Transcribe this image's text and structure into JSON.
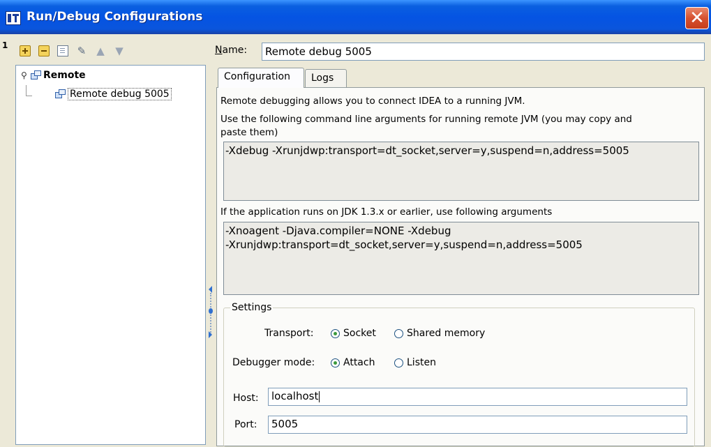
{
  "window": {
    "title": "Run/Debug Configurations",
    "close_glyph": "✕"
  },
  "toolbar": {
    "icons": [
      "add-icon",
      "remove-icon",
      "copy-icon",
      "wrench-icon",
      "move-up-icon",
      "move-down-icon"
    ]
  },
  "tree": {
    "root_label": "Remote",
    "child_label": "Remote debug 5005"
  },
  "form": {
    "name_label_underlined": "N",
    "name_label_rest": "ame:",
    "name_value": "Remote debug 5005"
  },
  "tabs": [
    {
      "label": "Configuration",
      "active": true
    },
    {
      "label": "Logs",
      "active": false
    }
  ],
  "config": {
    "intro": "Remote debugging allows you to connect IDEA to a running JVM.",
    "args_hint_line1": "Use the following command line arguments for running remote JVM (you may copy and",
    "args_hint_line2": "paste them)",
    "args": "-Xdebug -Xrunjdwp:transport=dt_socket,server=y,suspend=n,address=5005",
    "legacy_hint": "If the application runs on JDK 1.3.x or earlier, use following arguments",
    "legacy_args": "-Xnoagent -Djava.compiler=NONE -Xdebug\n-Xrunjdwp:transport=dt_socket,server=y,suspend=n,address=5005"
  },
  "settings": {
    "legend": "Settings",
    "transport_label": "Transport:",
    "transport_options": [
      {
        "label": "Socket",
        "selected": true
      },
      {
        "label": "Shared memory",
        "selected": false
      }
    ],
    "debugger_mode_label": "Debugger mode:",
    "debugger_mode_options": [
      {
        "label": "Attach",
        "selected": true
      },
      {
        "label": "Listen",
        "selected": false
      }
    ],
    "host_label": "Host:",
    "host_value": "localhost",
    "port_label": "Port:",
    "port_value": "5005"
  },
  "colors": {
    "titlebar": "#0554e3",
    "close": "#d65130",
    "radio_selected": "#3c9a3c"
  }
}
